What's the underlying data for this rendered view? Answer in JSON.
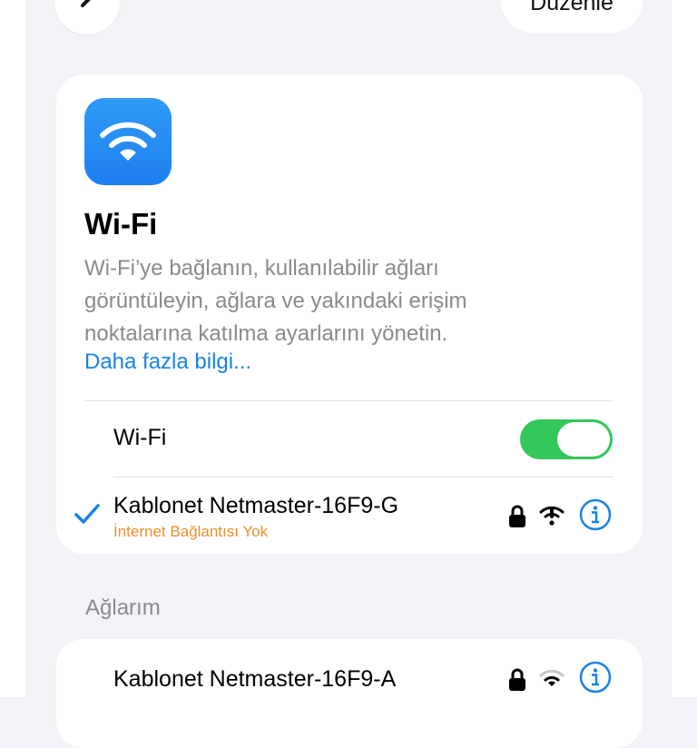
{
  "nav": {
    "back_icon": "chevron-left-icon",
    "edit_label": "Düzenle"
  },
  "header": {
    "app_icon": "wifi-icon",
    "title": "Wi-Fi",
    "description": "Wi‑Fi’ye bağlanın, kullanılabilir ağları görüntüleyin, ağlara ve yakındaki erişim noktalarına katılma ayarlarını yönetin.",
    "more_link": "Daha fazla bilgi..."
  },
  "wifi_toggle": {
    "label": "Wi-Fi",
    "on": true,
    "color": "#34c759"
  },
  "connected_network": {
    "name": "Kablonet Netmaster-16F9-G",
    "status": "İnternet Bağlantısı Yok",
    "status_color": "#e8912a",
    "icons": [
      "checkmark-icon",
      "lock-icon",
      "wifi-no-internet-icon",
      "info-icon"
    ]
  },
  "my_networks": {
    "header": "Ağlarım",
    "items": [
      {
        "name": "Kablonet Netmaster-16F9-A",
        "icons": [
          "lock-icon",
          "wifi-signal-icon",
          "info-icon"
        ]
      }
    ]
  },
  "accent_color": "#1a82e5"
}
